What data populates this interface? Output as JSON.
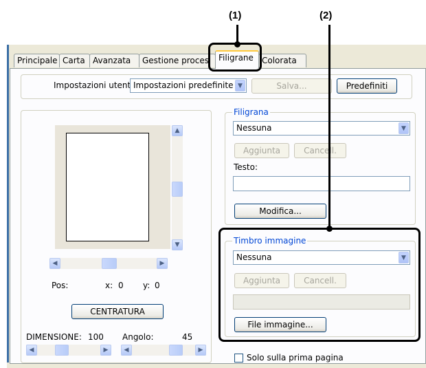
{
  "callouts": {
    "one": "(1)",
    "two": "(2)"
  },
  "tabs": [
    {
      "label": "Principale"
    },
    {
      "label": "Carta"
    },
    {
      "label": "Avanzata"
    },
    {
      "label": "Gestione proces"
    },
    {
      "label": "Filigrane",
      "active": true
    },
    {
      "label": "Colorata"
    }
  ],
  "user_settings": {
    "label": "Impostazioni utente:",
    "value": "Impostazioni predefinite",
    "save": "Salva...",
    "defaults": "Predefiniti"
  },
  "preview": {
    "pos_label": "Pos:",
    "x_label": "x:",
    "x_value": "0",
    "y_label": "y:",
    "y_value": "0",
    "center_button": "CENTRATURA",
    "size_label": "DIMENSIONE:",
    "size_value": "100",
    "angle_label": "Angolo:",
    "angle_value": "45"
  },
  "watermark": {
    "title": "Filigrana",
    "value": "Nessuna",
    "add": "Aggiunta",
    "cancel": "Cancell.",
    "text_label": "Testo:",
    "text_value": "",
    "edit": "Modifica..."
  },
  "stamp": {
    "title": "Timbro immagine",
    "value": "Nessuna",
    "add": "Aggiunta",
    "cancel": "Cancell.",
    "file_value": "",
    "file_button": "File immagine..."
  },
  "first_page_only": {
    "label": "Solo sulla prima pagina",
    "checked": false
  },
  "colors": {
    "callout": "#000000",
    "tab_highlight": "#ffc83c",
    "window_bg": "#ece9d8"
  }
}
